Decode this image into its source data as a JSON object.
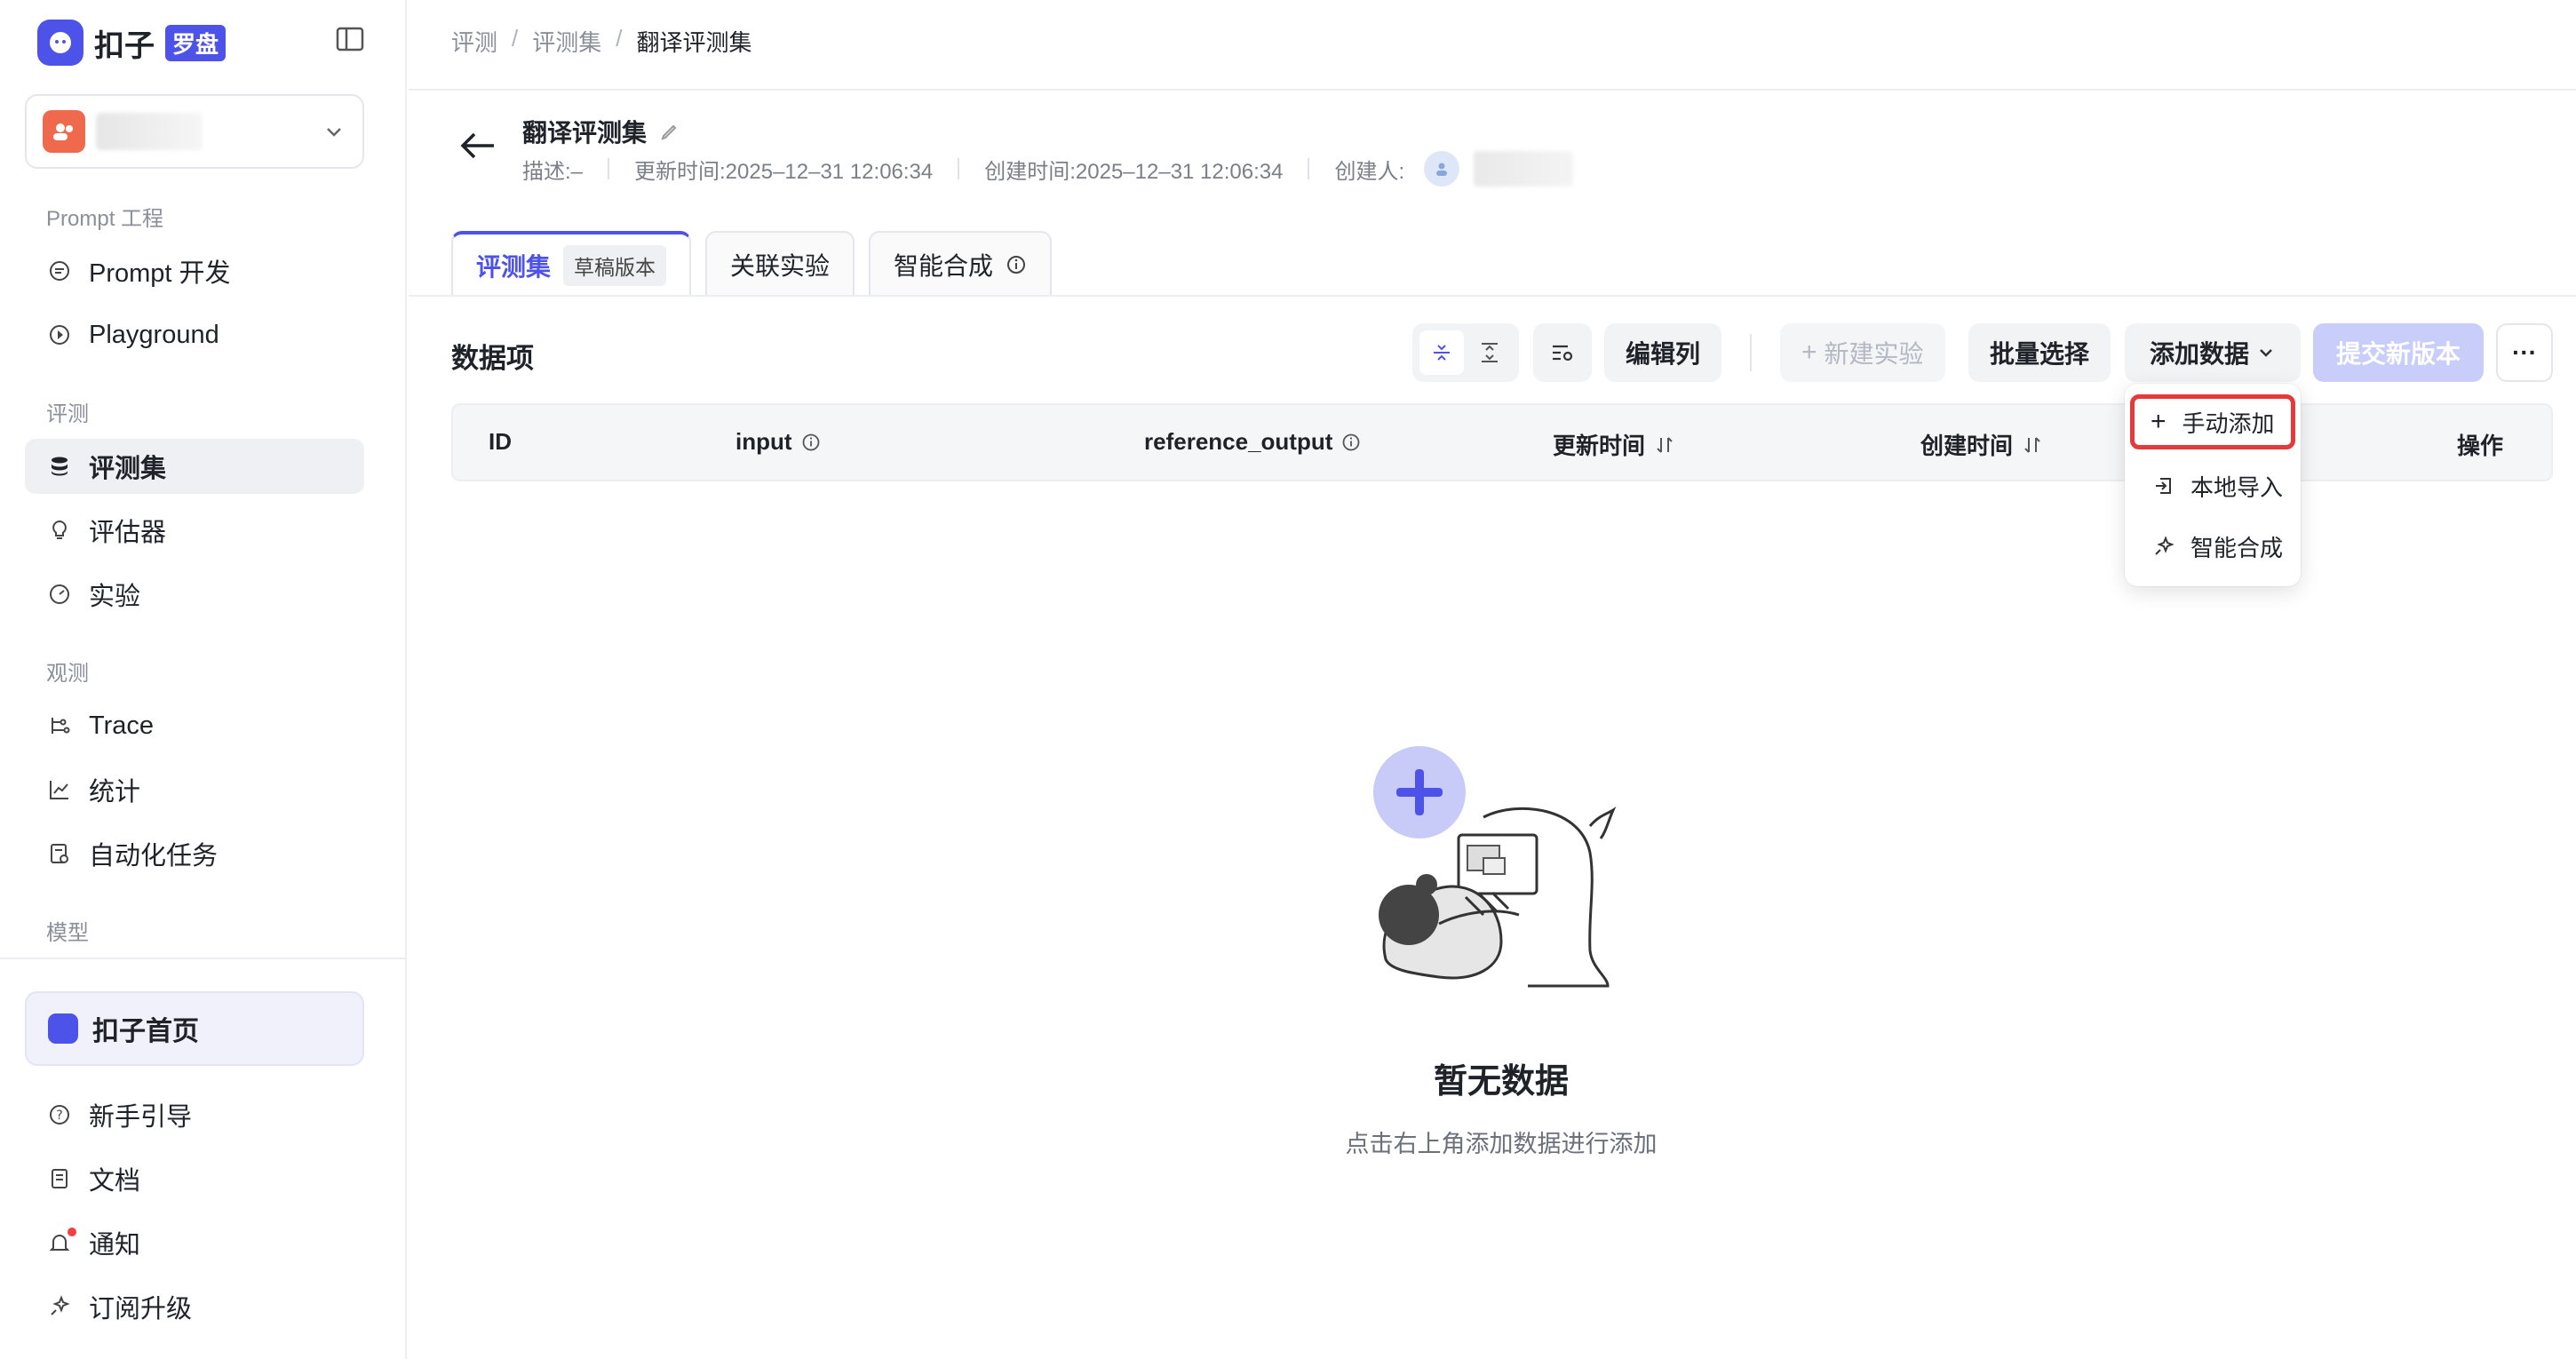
{
  "brand": {
    "name": "扣子",
    "badge": "罗盘"
  },
  "sidebar": {
    "sections": [
      {
        "label": "Prompt 工程"
      },
      {
        "label": "评测"
      },
      {
        "label": "观测"
      },
      {
        "label": "模型"
      }
    ],
    "items": [
      {
        "label": "Prompt 开发",
        "icon": "chat-icon"
      },
      {
        "label": "Playground",
        "icon": "play-icon"
      },
      {
        "label": "评测集",
        "icon": "database-icon",
        "active": true
      },
      {
        "label": "评估器",
        "icon": "bulb-icon"
      },
      {
        "label": "实验",
        "icon": "gauge-icon"
      },
      {
        "label": "Trace",
        "icon": "trace-icon"
      },
      {
        "label": "统计",
        "icon": "chart-icon"
      },
      {
        "label": "自动化任务",
        "icon": "task-icon"
      }
    ],
    "home": "扣子首页",
    "bottom": [
      {
        "label": "新手引导",
        "icon": "help-icon"
      },
      {
        "label": "文档",
        "icon": "doc-icon"
      },
      {
        "label": "通知",
        "icon": "bell-icon"
      },
      {
        "label": "订阅升级",
        "icon": "sparkle-icon"
      }
    ]
  },
  "breadcrumb": [
    "评测",
    "评测集",
    "翻译评测集"
  ],
  "dataset": {
    "title": "翻译评测集",
    "description": "描述:–",
    "updated": "更新时间:2025–12–31 12:06:34",
    "created": "创建时间:2025–12–31 12:06:34",
    "creator_label": "创建人:"
  },
  "tabs": [
    {
      "label": "评测集",
      "badge": "草稿版本",
      "active": true
    },
    {
      "label": "关联实验"
    },
    {
      "label": "智能合成"
    }
  ],
  "toolbar": {
    "section_title": "数据项",
    "edit_columns": "编辑列",
    "new_experiment": "新建实验",
    "batch_select": "批量选择",
    "add_data": "添加数据",
    "submit_version": "提交新版本",
    "more": "···"
  },
  "table": {
    "columns": [
      "ID",
      "input",
      "reference_output",
      "更新时间",
      "创建时间",
      "操作"
    ]
  },
  "dropdown": {
    "items": [
      {
        "label": "手动添加",
        "icon": "plus-icon",
        "highlighted": true
      },
      {
        "label": "本地导入",
        "icon": "import-icon"
      },
      {
        "label": "智能合成",
        "icon": "sparkle-icon"
      }
    ]
  },
  "empty_state": {
    "title": "暂无数据",
    "subtitle": "点击右上角添加数据进行添加"
  },
  "colors": {
    "accent": "#4d53e8",
    "highlight_border": "#e5393c"
  }
}
